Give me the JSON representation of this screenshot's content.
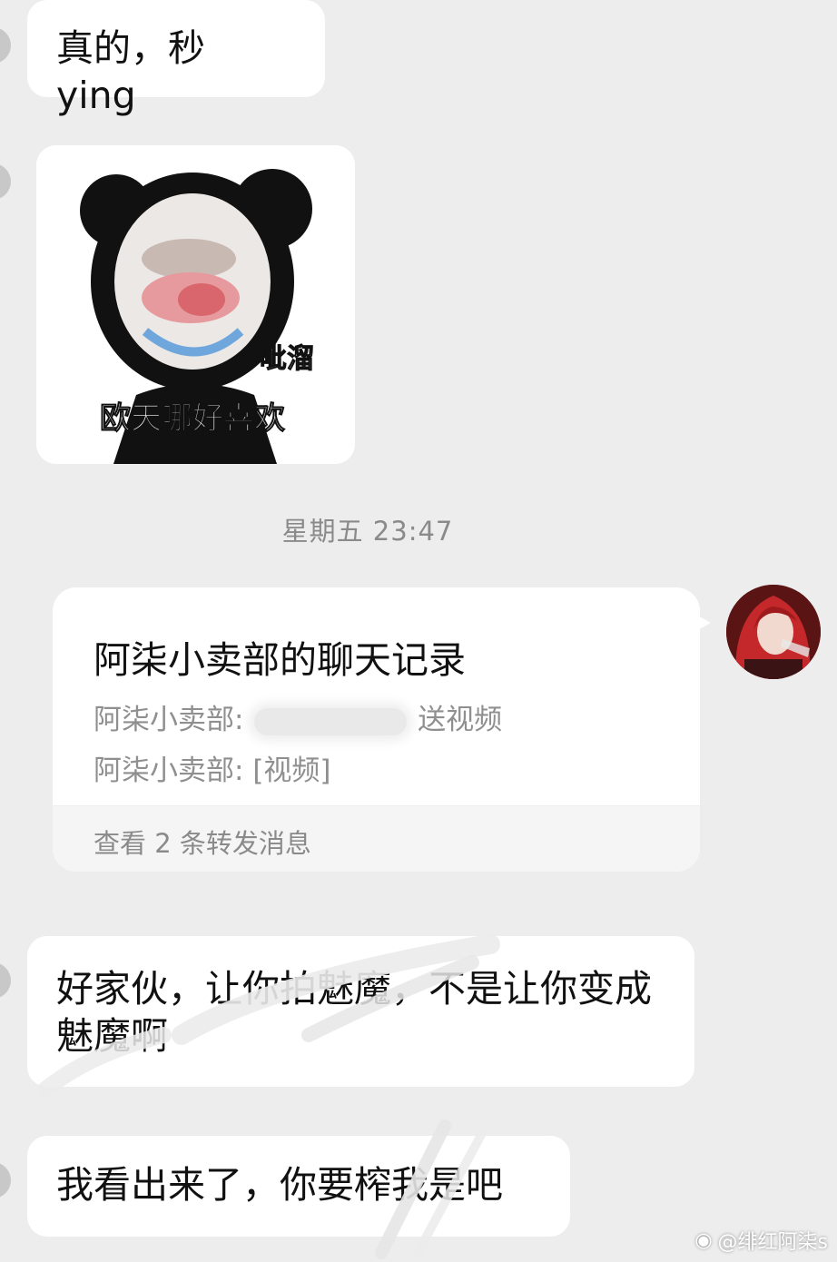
{
  "messages": {
    "m1": "真的，秒 ying",
    "sticker": {
      "caption_main": "欧天哪好喜欢",
      "caption_side": "呲溜"
    },
    "timestamp": "星期五 23:47",
    "forward_card": {
      "title": "阿柒小卖部的聊天记录",
      "line1_prefix": "阿柒小卖部:",
      "line1_suffix": "送视频",
      "line2_prefix": "阿柒小卖部:",
      "line2_suffix": "[视频]",
      "footer": "查看 2 条转发消息"
    },
    "m3": "好家伙，让你拍魅魔，不是让你变成魅魔啊",
    "m4": "我看出来了，你要榨我是吧"
  },
  "watermark": "@绯红阿柒s",
  "colors": {
    "background": "#ededed",
    "bubble": "#ffffff",
    "meta_text": "#8a8a8a"
  }
}
